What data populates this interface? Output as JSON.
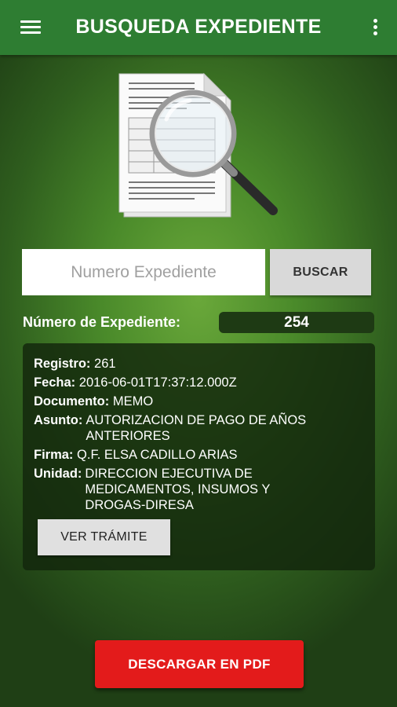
{
  "appbar": {
    "title": "BUSQUEDA EXPEDIENTE",
    "menu_icon": "hamburger-menu-icon",
    "overflow_icon": "more-vertical-icon"
  },
  "search": {
    "placeholder": "Numero Expediente",
    "value": "",
    "button_label": "BUSCAR"
  },
  "expediente": {
    "label": "Número de Expediente:",
    "value": "254"
  },
  "details": {
    "registro_label": "Registro:",
    "registro_value": "261",
    "fecha_label": "Fecha:",
    "fecha_value": "2016-06-01T17:37:12.000Z",
    "documento_label": "Documento:",
    "documento_value": "MEMO",
    "asunto_label": "Asunto:",
    "asunto_value": "AUTORIZACION DE PAGO DE AÑOS ANTERIORES",
    "firma_label": "Firma:",
    "firma_value": "Q.F. ELSA CADILLO ARIAS",
    "unidad_label": "Unidad:",
    "unidad_value": "DIRECCION EJECUTIVA DE MEDICAMENTOS, INSUMOS Y DROGAS-DIRESA",
    "ver_button_label": "VER TRÁMITE"
  },
  "footer": {
    "pdf_button_label": "DESCARGAR EN PDF"
  },
  "colors": {
    "appbar": "#2e7d32",
    "pdf_button": "#e31b1b",
    "card_background": "#12260c"
  }
}
